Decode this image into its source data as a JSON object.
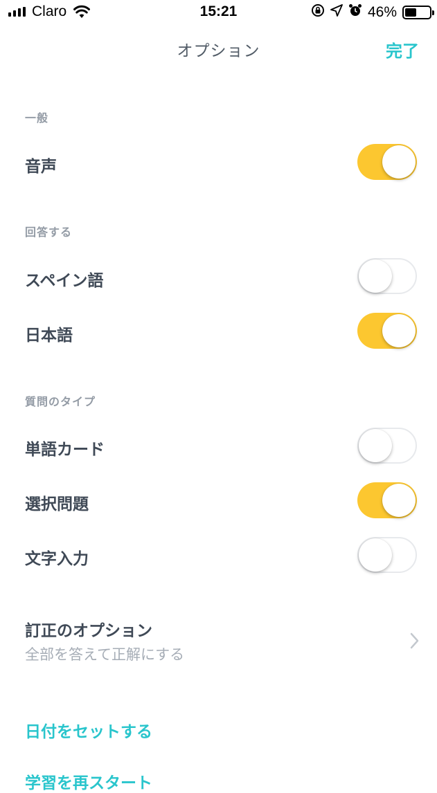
{
  "status_bar": {
    "carrier": "Claro",
    "time": "15:21",
    "battery": "46%",
    "battery_level": 0.46,
    "icons": [
      "signal-bars-icon",
      "wifi-icon",
      "orientation-lock-icon",
      "location-arrow-icon",
      "alarm-clock-icon",
      "battery-icon"
    ]
  },
  "nav": {
    "title": "オプション",
    "done_label": "完了"
  },
  "sections": {
    "general": {
      "header": "一般",
      "audio_label": "音声",
      "audio_on": true
    },
    "answer_with": {
      "header": "回答する",
      "spanish_label": "スペイン語",
      "spanish_on": false,
      "japanese_label": "日本語",
      "japanese_on": true
    },
    "question_types": {
      "header": "質問のタイプ",
      "flashcards_label": "単語カード",
      "flashcards_on": false,
      "multiple_choice_label": "選択問題",
      "multiple_choice_on": true,
      "written_label": "文字入力",
      "written_on": false
    },
    "correction": {
      "title": "訂正のオプション",
      "subtitle": "全部を答えて正解にする"
    }
  },
  "links": {
    "set_date": "日付をセットする",
    "restart": "学習を再スタート"
  },
  "colors": {
    "accent": "#29c5cc",
    "toggle_on": "#fcc730",
    "text": "#3f4956",
    "section_header": "#939ba5"
  }
}
